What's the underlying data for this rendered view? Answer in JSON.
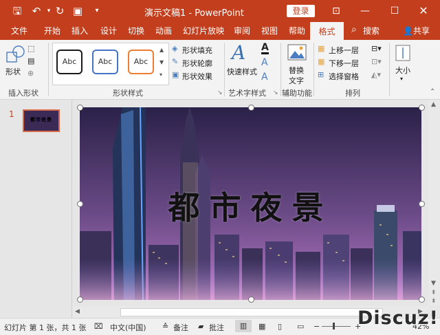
{
  "app": {
    "title": "演示文稿1 - PowerPoint",
    "login_label": "登录",
    "share_label": "共享",
    "search_label": "搜索"
  },
  "tabs": [
    "文件",
    "开始",
    "插入",
    "设计",
    "切换",
    "动画",
    "幻灯片放映",
    "审阅",
    "视图",
    "帮助",
    "格式"
  ],
  "active_tab": "格式",
  "ribbon": {
    "insert_shapes": {
      "shapes_label": "形状",
      "group_label": "插入形状"
    },
    "shape_styles": {
      "swatches": [
        "Abc",
        "Abc",
        "Abc"
      ],
      "fill_label": "形状填充",
      "outline_label": "形状轮廓",
      "effects_label": "形状效果",
      "group_label": "形状样式"
    },
    "wordart": {
      "quick_styles_label": "快速样式",
      "group_label": "艺术字样式"
    },
    "accessibility": {
      "alt_text_label_line1": "替换",
      "alt_text_label_line2": "文字",
      "group_label": "辅助功能"
    },
    "arrange": {
      "bring_forward_label": "上移一层",
      "send_backward_label": "下移一层",
      "selection_pane_label": "选择窗格",
      "group_label": "排列"
    },
    "size": {
      "size_label": "大小"
    }
  },
  "slides_pane": {
    "slide_number": "1"
  },
  "slide": {
    "title_text": "都市夜景"
  },
  "statusbar": {
    "slide_info": "幻灯片 第 1 张，共 1 张",
    "language": "中文(中国)",
    "notes_label": "备注",
    "comments_label": "批注",
    "zoom": "42%"
  },
  "watermark": "Discuz!",
  "colors": {
    "accent": "#c23e1c",
    "swatch_black": "#1a1a1a",
    "swatch_blue": "#4472c4",
    "swatch_orange": "#ed7d31"
  }
}
